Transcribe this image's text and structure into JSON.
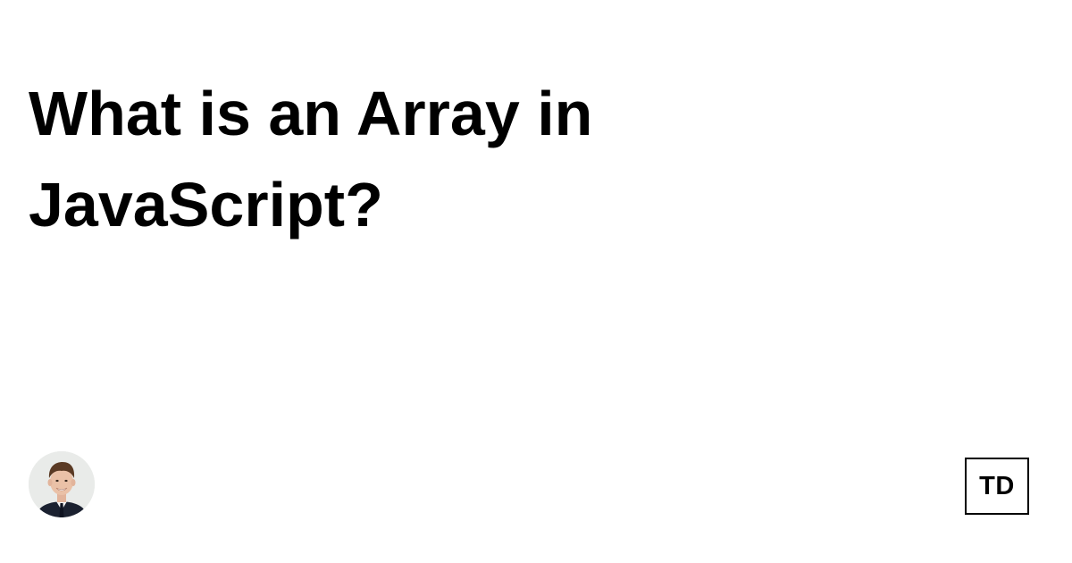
{
  "article": {
    "title": "What is an Array in JavaScript?"
  },
  "author": {
    "avatar_icon": "author-avatar-photo"
  },
  "site": {
    "logo_text": "TD",
    "logo_icon": "site-logo-badge"
  },
  "colors": {
    "background": "#ffffff",
    "text": "#000000",
    "avatar_background": "#e9ebe9"
  }
}
